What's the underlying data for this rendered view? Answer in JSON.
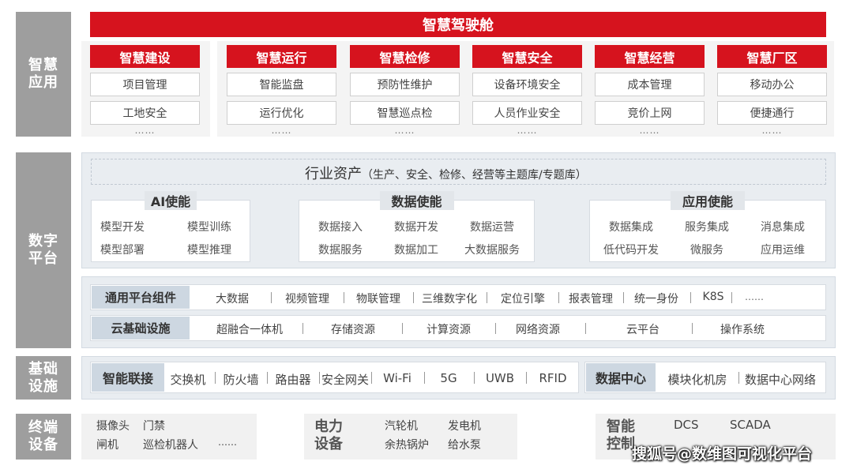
{
  "app": {
    "side_labels": [
      "智慧\n应用",
      "数字\n平台",
      "基础\n设施",
      "终端\n设备"
    ],
    "top_title": "智慧驾驶舱",
    "app_columns": [
      {
        "header": "智慧建设",
        "items": [
          "项目管理",
          "工地安全"
        ],
        "more": "……"
      },
      {
        "header": "智慧运行",
        "items": [
          "智能监盘",
          "运行优化"
        ],
        "more": "……"
      },
      {
        "header": "智慧检修",
        "items": [
          "预防性维护",
          "智慧巡点检"
        ],
        "more": "……"
      },
      {
        "header": "智慧安全",
        "items": [
          "设备环境安全",
          "人员作业安全"
        ],
        "more": "……"
      },
      {
        "header": "智慧经营",
        "items": [
          "成本管理",
          "竞价上网"
        ],
        "more": "……"
      },
      {
        "header": "智慧厂区",
        "items": [
          "移动办公",
          "便捷通行"
        ],
        "more": "……"
      }
    ]
  },
  "platform": {
    "assets_title": "行业资产",
    "assets_sub": "（生产、安全、检修、经营等主题库/专题库）",
    "cards": [
      {
        "title": "AI使能",
        "items": [
          "模型开发",
          "模型训练",
          "模型部署",
          "模型推理"
        ]
      },
      {
        "title": "数据使能",
        "items": [
          "数据接入",
          "数据开发",
          "数据运营",
          "数据服务",
          "数据加工",
          "大数据服务"
        ]
      },
      {
        "title": "应用使能",
        "items": [
          "数据集成",
          "服务集成",
          "消息集成",
          "低代码开发",
          "微服务",
          "应用运维"
        ]
      }
    ],
    "rows": [
      {
        "label": "通用平台组件",
        "items": [
          "大数据",
          "视频管理",
          "物联管理",
          "三维数字化",
          "定位引擎",
          "报表管理",
          "统一身份",
          "K8S",
          "……"
        ]
      },
      {
        "label": "云基础设施",
        "items": [
          "超融合一体机",
          "存储资源",
          "计算资源",
          "网络资源",
          "云平台",
          "操作系统"
        ]
      }
    ]
  },
  "infra": {
    "left_label": "智能联接",
    "left_items": [
      "交换机",
      "防火墙",
      "路由器",
      "安全网关",
      "Wi-Fi",
      "5G",
      "UWB",
      "RFID"
    ],
    "right_label": "数据中心",
    "right_items": [
      "模块化机房",
      "数据中心网络"
    ]
  },
  "terminal": {
    "group1": {
      "items": [
        "摄像头",
        "门禁",
        "闸机",
        "巡检机器人",
        "……"
      ]
    },
    "group2": {
      "label": "电力\n设备",
      "items": [
        "汽轮机",
        "发电机",
        "余热锅炉",
        "给水泵"
      ]
    },
    "group3": {
      "label": "智能\n控制",
      "items": [
        "DCS",
        "SCADA"
      ]
    }
  },
  "watermark": "搜狐号@数维图可视化平台",
  "colors": {
    "accent_red": "#d6131e",
    "side_gray": "#9e9e9e",
    "panel_bg": "#e9edf1",
    "label_blue": "#cdd7e1"
  }
}
